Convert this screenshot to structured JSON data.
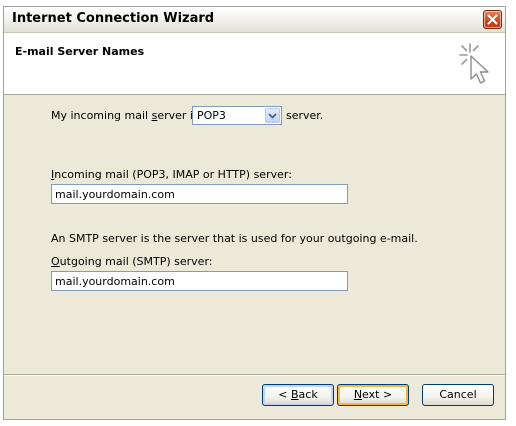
{
  "window": {
    "title": "Internet Connection Wizard"
  },
  "header": {
    "title": "E-mail Server Names"
  },
  "incoming_type": {
    "prefix_before": "My incoming mail ",
    "prefix_access": "s",
    "prefix_after": "erver is a",
    "selected": "POP3",
    "suffix": "server."
  },
  "incoming_server": {
    "label_access": "I",
    "label_rest": "ncoming mail (POP3, IMAP or HTTP) server:",
    "value": "mail.yourdomain.com"
  },
  "smtp_note": "An SMTP server is the server that is used for your outgoing e-mail.",
  "outgoing_server": {
    "label_access": "O",
    "label_rest": "utgoing mail (SMTP) server:",
    "value": "mail.yourdomain.com"
  },
  "buttons": {
    "back_prefix": "< ",
    "back_access": "B",
    "back_rest": "ack",
    "next_access": "N",
    "next_rest": "ext >",
    "cancel": "Cancel"
  },
  "icons": {
    "close": "close-icon",
    "wizard": "wizard-cursor-icon",
    "dropdown": "chevron-down-icon"
  },
  "colors": {
    "close_button": "#d6451c",
    "field_border": "#7f9db9",
    "dialog_bg": "#ece9d8"
  }
}
